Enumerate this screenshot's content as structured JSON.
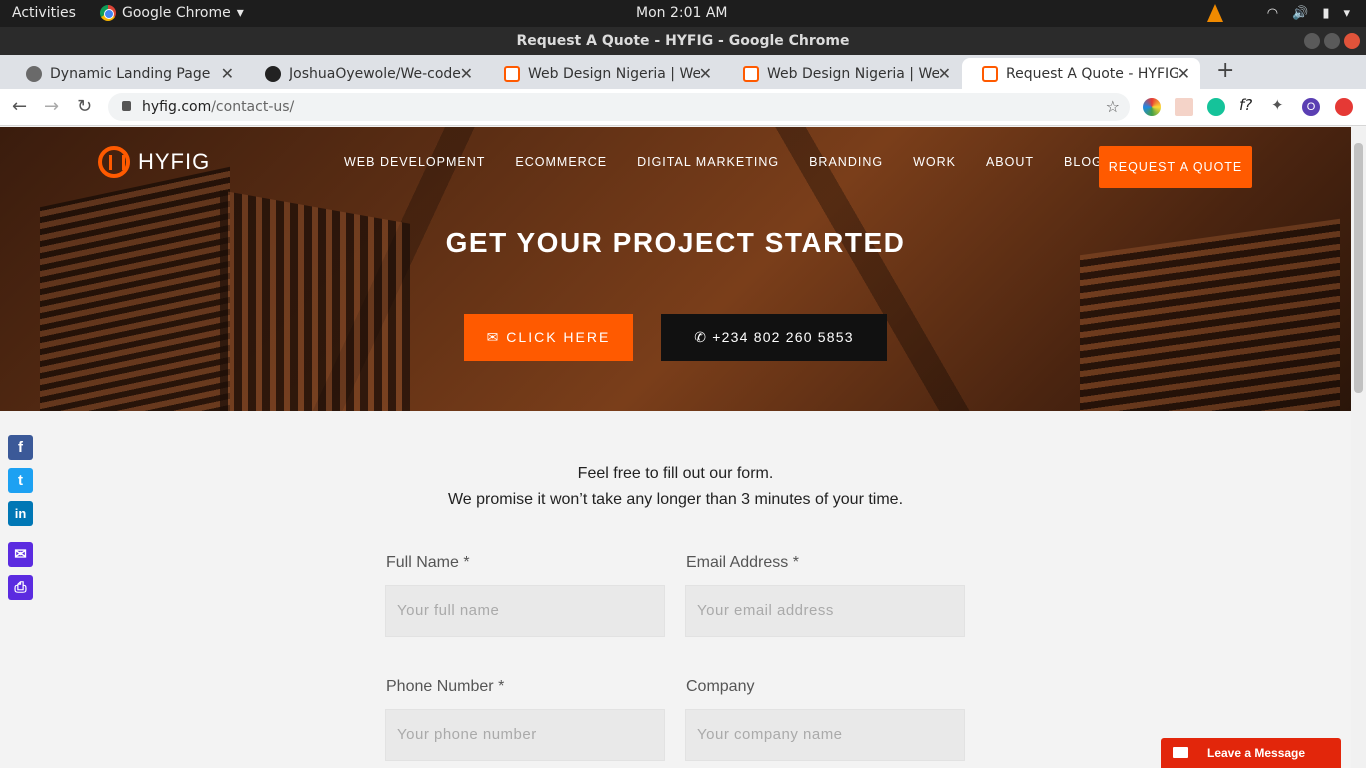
{
  "os": {
    "activities": "Activities",
    "app_name": "Google Chrome",
    "clock": "Mon  2:01 AM"
  },
  "window": {
    "title": "Request A Quote - HYFIG - Google Chrome"
  },
  "tabs": [
    {
      "title": "Dynamic Landing Page",
      "favicon": "globe-icon"
    },
    {
      "title": "JoshuaOyewole/We-code",
      "favicon": "github-icon"
    },
    {
      "title": "Web Design Nigeria | Web",
      "favicon": "hyfig-icon"
    },
    {
      "title": "Web Design Nigeria | Web",
      "favicon": "hyfig-icon"
    },
    {
      "title": "Request A Quote - HYFIG",
      "favicon": "hyfig-icon",
      "active": true
    }
  ],
  "toolbar": {
    "url_host": "hyfig.com",
    "url_path": "/contact-us/"
  },
  "site": {
    "brand": "HYFIG",
    "nav": [
      "WEB DEVELOPMENT",
      "ECOMMERCE",
      "DIGITAL MARKETING",
      "BRANDING",
      "WORK",
      "ABOUT",
      "BLOG"
    ],
    "quote_button": "REQUEST A QUOTE",
    "hero_title": "GET YOUR PROJECT STARTED",
    "cta_click": "CLICK HERE",
    "cta_phone": "+234 802 260 5853",
    "accent_color": "#ff5a00"
  },
  "share": [
    "facebook-icon",
    "twitter-icon",
    "linkedin-icon",
    "email-icon",
    "print-icon"
  ],
  "form": {
    "intro_line1": "Feel free to fill out our form.",
    "intro_line2": "We promise it won’t take any longer than 3 minutes of your time.",
    "full_name_label": "Full Name *",
    "full_name_placeholder": "Your full name",
    "email_label": "Email Address *",
    "email_placeholder": "Your email address",
    "phone_label": "Phone Number *",
    "phone_placeholder": "Your phone number",
    "company_label": "Company",
    "company_placeholder": "Your company name"
  },
  "chat": {
    "label": "Leave a Message"
  }
}
